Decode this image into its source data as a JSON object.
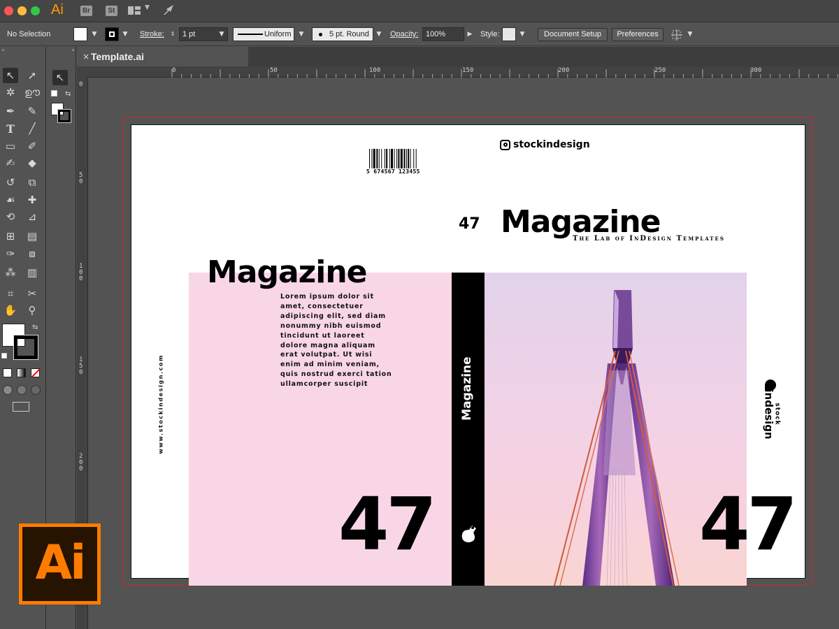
{
  "app": {
    "title_icon": "Ai",
    "bridge": "Br",
    "stock": "St"
  },
  "controlbar": {
    "selection": "No Selection",
    "stroke_label": "Stroke:",
    "stroke_weight": "1 pt",
    "profile": "Uniform",
    "brush": "5 pt. Round",
    "opacity_label": "Opacity:",
    "opacity": "100%",
    "style_label": "Style:",
    "doc_setup": "Document Setup",
    "preferences": "Preferences"
  },
  "document": {
    "tab_name": "Template.ai",
    "close": "×"
  },
  "ruler": {
    "h_ticks": [
      "0",
      "50",
      "100",
      "150",
      "200",
      "250",
      "300"
    ],
    "v_ticks": [
      "0",
      "5\n0",
      "1\n0\n0",
      "1\n5\n0",
      "2\n0\n0"
    ]
  },
  "artwork": {
    "barcode_digits": "5 674567 123455",
    "instagram": "stockindesign",
    "front_issue_small": "47",
    "front_title": "Magazine",
    "front_subtitle": "The Lab of InDesign Templates",
    "back_title": "Magazine",
    "back_body": "Lorem ipsum dolor sit amet, consectetuer adipiscing elit, sed diam nonummy nibh euismod tincidunt ut laoreet dolore magna aliquam erat volutpat. Ut wisi enim ad minim veniam, quis nostrud exerci tation ullamcorper suscipit",
    "side_url": "www.stockindesign.com",
    "spine_title": "Magazine",
    "issue_back": "47",
    "issue_front": "47",
    "brand_top": "stock",
    "brand_bottom": "indesign"
  },
  "badge": {
    "text": "Ai"
  },
  "colors": {
    "accent": "#ff7c00",
    "bleed_guide": "#d0271f",
    "back_cover": "#f8d6e6"
  }
}
